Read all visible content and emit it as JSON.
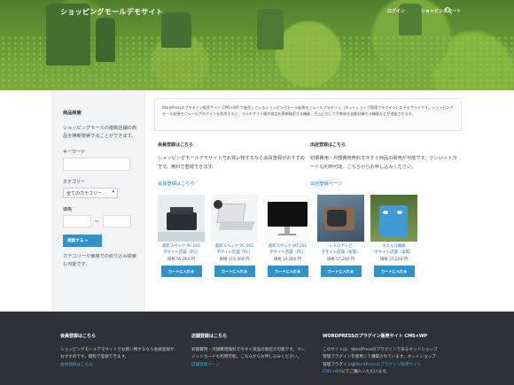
{
  "header": {
    "site_title": "ショッピングモールデモサイト",
    "nav": [
      "ログイン",
      "ショッピングカート"
    ],
    "search_icon": "search-icon"
  },
  "sidebar": {
    "title": "商品検索",
    "description": "ショッピングモールの複数店舗の商品を横断検索することができます。",
    "keyword_label": "キーワード",
    "keyword_value": "",
    "category_label": "カテゴリー",
    "category_selected": "全てのカテゴリー",
    "price_label": "価格",
    "price_sep": "〜",
    "search_button": "検索する »",
    "note": "カテゴリーや価格での絞り込み検索も可能です。"
  },
  "notice": "WordPressのプラグイン販売サイト CMS×WP で販売しているショッピングモール拡張モジュールプラグイン（ネットショップ管理プラグイン）のデモサイトです。ショッピングモール拡張モジュールプラグインを利用すると、マルチサイト間の商品を横断検索する機能、売上に対して手数料を自動計算する機能などが追加されます。",
  "member": {
    "title": "会員登録はこちら",
    "text": "ショッピングモールデモサイトでお買い物するなら会員登録がおすすめです。無料で登録できます。",
    "link": "会員登録はこちら"
  },
  "seller": {
    "title": "出店登録はこちら",
    "text": "初期費用・月額費用無料で今すぐ商品の販売が可能です。クレジットカードも利用可能。こちらからお申し込みください。",
    "link": "出店登録ページ"
  },
  "products": [
    {
      "title": "最新スペック PE-101\n子サイト店舗（PC）",
      "price": "価格 55,000 円",
      "button": "カートに入れる",
      "image": "printer-image"
    },
    {
      "title": "最新スペック PC-001\n子サイト店舗（PC）",
      "price": "価格 110,000 円",
      "button": "カートに入れる",
      "image": "laptop-image"
    },
    {
      "title": "最新スペック MT-201\n子サイト店舗（PC）",
      "price": "価格 33,000 円",
      "button": "カートに入れる",
      "image": "monitor-image"
    },
    {
      "title": "レトロテレビ\n子サイト店舗（家電）",
      "price": "価格 57,200 円",
      "button": "カートに入れる",
      "image": "retro-tv-image"
    },
    {
      "title": "カエル冷蔵庫\n子サイト店舗（家電）",
      "price": "価格 27,500 円",
      "button": "カートに入れる",
      "image": "fridge-image"
    }
  ],
  "footer": {
    "col1": {
      "title": "会員登録はこちら",
      "text": "ショッピングモールデモサイトでお買い物するなら会員登録がおすすめです。無料で登録できます。",
      "link": "会員登録はこちら"
    },
    "col2": {
      "title": "店舗登録はこちら",
      "text": "初期費用・月額費用無料で今すぐ商品の販売が可能です。クレジットカードも利用可能。こちらからお申し込みください。",
      "link": "店舗登録ページ"
    },
    "col3": {
      "title": "WORDPRESSのプラグイン販売サイト CMS×WP",
      "text_before": "このサイトは、WordPressのプラグインであるネットショップ管理プラグインを使用して構築されています。ネットショップ管理プラグインは",
      "link": "WordPressのプラグイン販売サイト CMS×WP",
      "text_after": "にてご購入いただけます。"
    }
  },
  "colors": {
    "accent": "#2f93c9",
    "footer_bg": "#2d3136",
    "sidebar_bg": "#f1f3f4"
  }
}
